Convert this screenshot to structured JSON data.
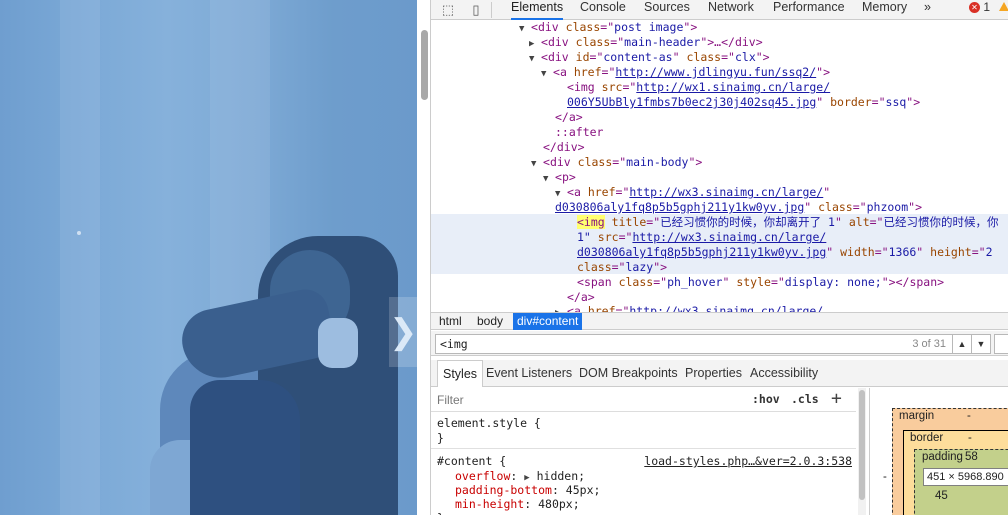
{
  "devtools": {
    "tabs": [
      "Elements",
      "Console",
      "Sources",
      "Network",
      "Performance",
      "Memory"
    ],
    "more_tabs_icon": "»",
    "error_count": "1",
    "dom_lines": {
      "l1_tag": "div",
      "l1_attr": "class",
      "l1_val": "post image",
      "l2_tag": "div",
      "l2_attr": "class",
      "l2_val": "main-header",
      "l2_rest": "…</div>",
      "l3_tag": "div",
      "l3_attr1": "id",
      "l3_val1": "content-as",
      "l3_attr2": "class",
      "l3_val2": "clx",
      "l4_tag": "a",
      "l4_attr": "href",
      "l4_link": "http://www.jdlingyu.fun/ssq2/",
      "l5_tag": "img",
      "l5_attr": "src",
      "l5_link": "http://wx1.sinaimg.cn/large/",
      "l6_link": "006Y5UbBly1fmbs7b0ec2j30j402sq45.jpg",
      "l6_attr": "border",
      "l6_val": "ssq",
      "l7": "</a>",
      "l8": "::after",
      "l9": "</div>",
      "l10_tag": "div",
      "l10_attr": "class",
      "l10_val": "main-body",
      "l11_tag": "p",
      "l12_tag": "a",
      "l12_attr": "href",
      "l12_link": "http://wx3.sinaimg.cn/large/",
      "l13_link": "d030806aly1fq8p5b5gphj211y1kw0yv.jpg",
      "l13_attr": "class",
      "l13_val": "phzoom",
      "l14_tag": "<img",
      "l14_attr1": "title",
      "l14_val1": "已经习惯你的时候，你却离开了 1",
      "l14_attr2": "alt",
      "l14_val2": "已经习惯你的时候，你",
      "l15_val": "1\"",
      "l15_attr": "src",
      "l15_link": "http://wx3.sinaimg.cn/large/",
      "l16_link": "d030806aly1fq8p5b5gphj211y1kw0yv.jpg",
      "l16_attr1": "width",
      "l16_val1": "1366",
      "l16_attr2": "height",
      "l16_val2": "2",
      "l17_attr": "class",
      "l17_val": "lazy",
      "l18_tag": "span",
      "l18_attr1": "class",
      "l18_val1": "ph_hover",
      "l18_attr2": "style",
      "l18_val2": "display: none;",
      "l18_close": "></span>",
      "l19": "</a>",
      "l20_tag": "a",
      "l20_attr": "href",
      "l20_link": "http://wx3.sinaimg.cn/large/"
    },
    "breadcrumbs": [
      "html",
      "body",
      "div#content"
    ],
    "search": {
      "query": "<img",
      "count": "3 of 31"
    },
    "panel_tabs": [
      "Styles",
      "Event Listeners",
      "DOM Breakpoints",
      "Properties",
      "Accessibility"
    ],
    "styles": {
      "filter_placeholder": "Filter",
      "hov": ":hov",
      "cls": ".cls",
      "plus": "+",
      "element_style": "element.style {",
      "close1": "}",
      "rule_selector": "#content {",
      "rule_source": "load-styles.php…&ver=2.0.3:538",
      "p1_name": "overflow",
      "p1_val": "hidden;",
      "p2_name": "padding-bottom",
      "p2_val": "45px;",
      "p3_name": "min-height",
      "p3_val": "480px;",
      "close2": "}"
    },
    "box_model": {
      "margin_label": "margin",
      "margin_val": "-",
      "border_label": "border",
      "border_val": "-",
      "padding_label": "padding",
      "padding_val": "58",
      "content": "451 × 5968.890",
      "left_dash": "-",
      "bottom_val": "45"
    }
  }
}
